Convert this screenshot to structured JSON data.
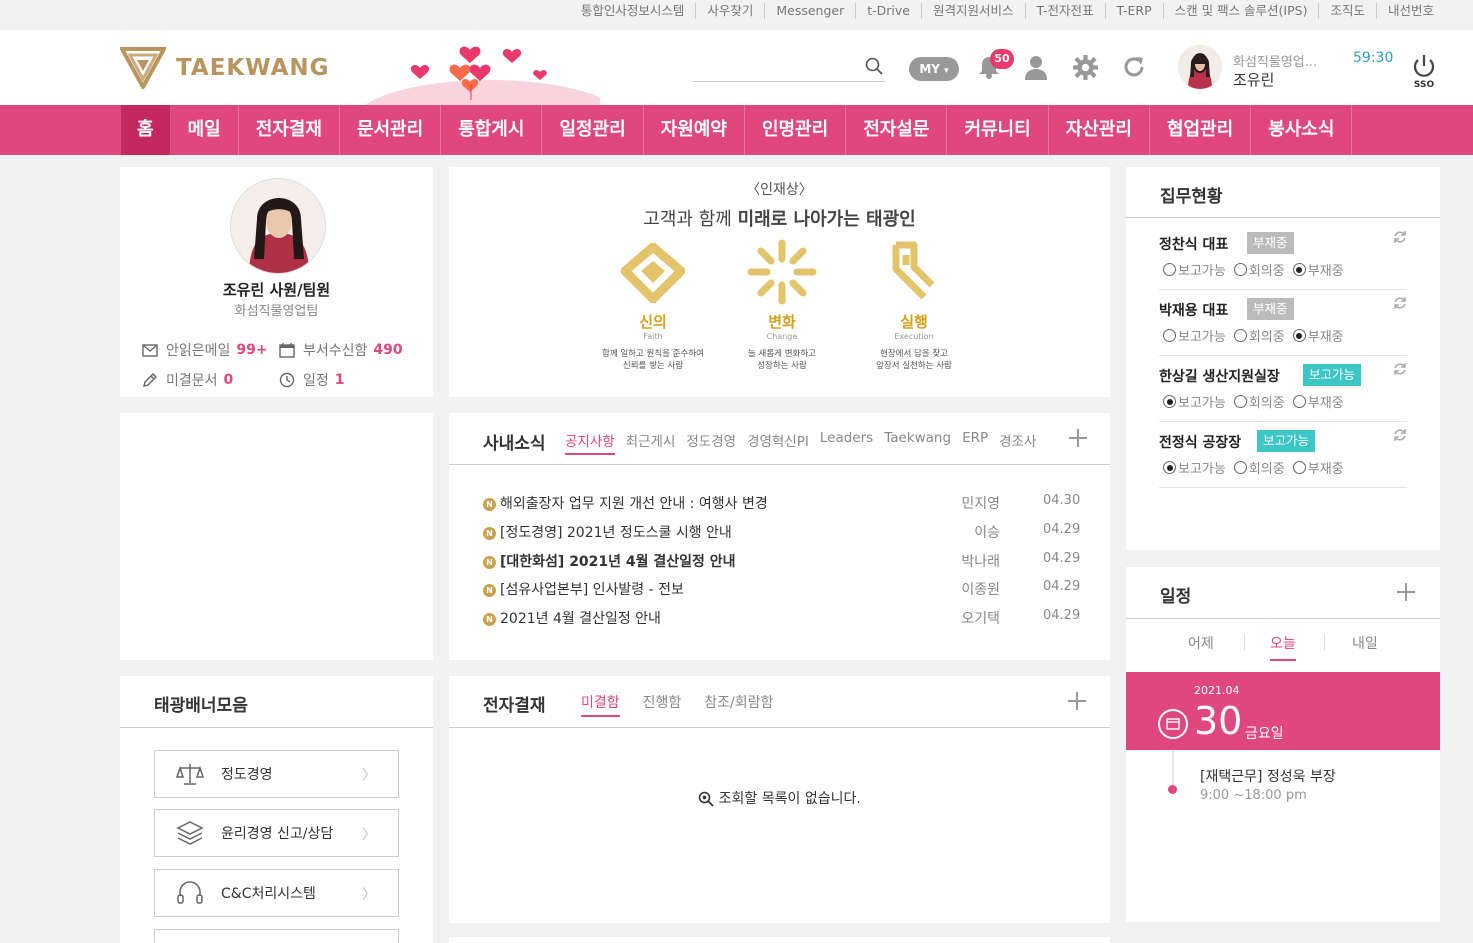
{
  "util_links": [
    "통합인사정보시스템",
    "사우찾기",
    "Messenger",
    "t-Drive",
    "원격지원서비스",
    "T-전자전표",
    "T-ERP",
    "스캔 및 팩스 솔루션(IPS)",
    "조직도",
    "내선번호"
  ],
  "header": {
    "logo_text": "TAEKWANG",
    "search_placeholder": "",
    "my_label": "MY",
    "notification_count": "50",
    "user_dept": "화섬직물영업...",
    "user_name": "조유린",
    "timer": "59:30",
    "sso_label": "SSO"
  },
  "nav": [
    "홈",
    "메일",
    "전자결재",
    "문서관리",
    "통합게시",
    "일정관리",
    "자원예약",
    "인명관리",
    "전자설문",
    "커뮤니티",
    "자산관리",
    "협업관리",
    "봉사소식"
  ],
  "profile": {
    "name": "조유린 사원/팀원",
    "dept": "화섬직물영업팀",
    "unread_mail_label": "안읽은메일",
    "unread_mail_count": "99+",
    "dept_inbox_label": "부서수신함",
    "dept_inbox_count": "490",
    "pending_docs_label": "미결문서",
    "pending_docs_count": "0",
    "schedule_label": "일정",
    "schedule_count": "1"
  },
  "banner": {
    "heading": "〈인재상〉",
    "subtitle_light": "고객과 함께",
    "subtitle_bold": "미래로 나아가는 태광인",
    "values": [
      {
        "kr": "신의",
        "en": "Faith",
        "desc1": "함께 일하고 원칙을 준수하여",
        "desc2": "신뢰를 쌓는 사람"
      },
      {
        "kr": "변화",
        "en": "Change",
        "desc1": "늘 새롭게 변화하고",
        "desc2": "성장하는 사람"
      },
      {
        "kr": "실행",
        "en": "Execution",
        "desc1": "현장에서 답을 찾고",
        "desc2": "앞장서 실천하는 사람"
      }
    ]
  },
  "news": {
    "title": "사내소식",
    "tabs": [
      "공지사항",
      "최근게시",
      "정도경영",
      "경영혁신PI",
      "Leaders",
      "Taekwang",
      "ERP",
      "경조사"
    ],
    "active_tab": "공지사항",
    "items": [
      {
        "title": "해외출장자 업무 지원 개선 안내 : 여행사 변경",
        "author": "민지영",
        "date": "04.30"
      },
      {
        "title": "[정도경영] 2021년 정도스쿨 시행 안내",
        "author": "이승",
        "date": "04.29"
      },
      {
        "title": "[대한화섬] 2021년 4월 결산일정 안내",
        "author": "박나래",
        "date": "04.29"
      },
      {
        "title": "[섬유사업본부] 인사발령 - 전보",
        "author": "이종원",
        "date": "04.29"
      },
      {
        "title": "2021년 4월 결산일정 안내",
        "author": "오기택",
        "date": "04.29"
      }
    ],
    "new_badge": "N"
  },
  "banners_collection": {
    "title": "태광배너모음",
    "items": [
      "정도경영",
      "윤리경영 신고/상담",
      "C&C처리시스템"
    ]
  },
  "approval": {
    "title": "전자결재",
    "tabs": [
      "미결함",
      "진행함",
      "참조/회람함"
    ],
    "active_tab": "미결함",
    "empty_text": "조회할 목록이 없습니다."
  },
  "attendance": {
    "title": "집무현황",
    "option_labels": [
      "보고가능",
      "회의중",
      "부재중"
    ],
    "rows": [
      {
        "name": "정찬식 대표",
        "badge": "부재중",
        "badge_type": "away",
        "selected": 2
      },
      {
        "name": "박재용 대표",
        "badge": "부재중",
        "badge_type": "away",
        "selected": 2
      },
      {
        "name": "한상길 생산지원실장",
        "badge": "보고가능",
        "badge_type": "avail",
        "selected": 0
      },
      {
        "name": "전정식 공장장",
        "badge": "보고가능",
        "badge_type": "avail",
        "selected": 0
      }
    ]
  },
  "schedule": {
    "title": "일정",
    "days": [
      "어제",
      "오늘",
      "내일"
    ],
    "active_day": "오늘",
    "month": "2021.04",
    "day": "30",
    "weekday": "금요일",
    "event_title": "[재택근무] 정성욱 부장",
    "event_time": "9:00 ~18:00 pm"
  },
  "colors": {
    "brand_pink": "#e0477e",
    "nav_active": "#c3285f",
    "gold": "#b8945e",
    "teal": "#3cc6c6",
    "timer": "#2aa0c2"
  }
}
